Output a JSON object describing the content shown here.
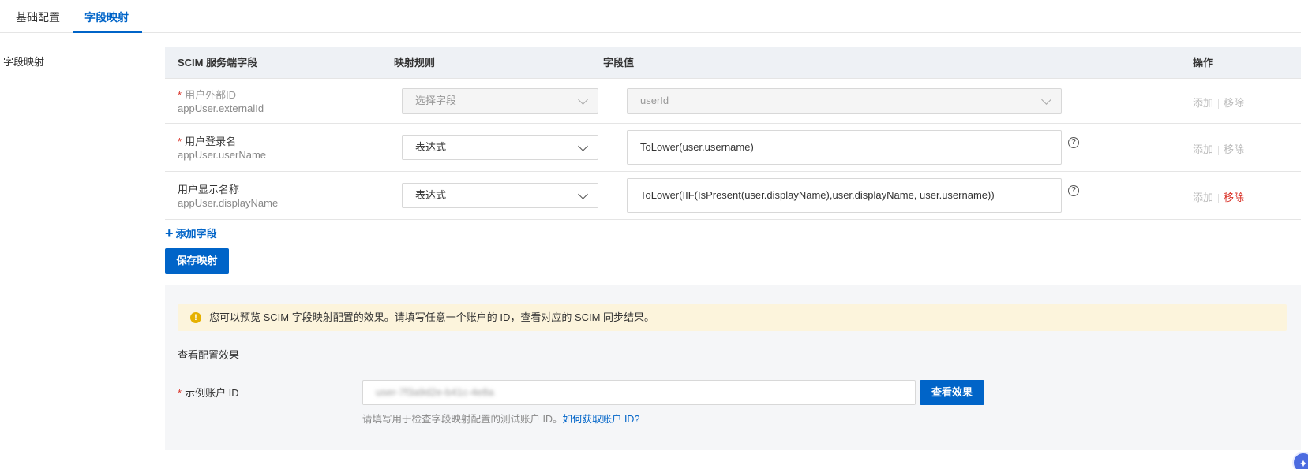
{
  "tabs": [
    {
      "label": "基础配置",
      "active": false
    },
    {
      "label": "字段映射",
      "active": true
    }
  ],
  "side_label": "字段映射",
  "table": {
    "headers": {
      "field": "SCIM 服务端字段",
      "rule": "映射规则",
      "value": "字段值",
      "ops": "操作"
    },
    "rows": [
      {
        "name": "用户外部ID",
        "required": "*",
        "code": "appUser.externalId",
        "rule": "选择字段",
        "value": "userId",
        "add": "添加",
        "remove": "移除"
      },
      {
        "name": "用户登录名",
        "required": "*",
        "code": "appUser.userName",
        "rule": "表达式",
        "value": "ToLower(user.username)",
        "add": "添加",
        "remove": "移除"
      },
      {
        "name": "用户显示名称",
        "code": "appUser.displayName",
        "rule": "表达式",
        "value": "ToLower(IIF(IsPresent(user.displayName),user.displayName, user.username))",
        "add": "添加",
        "remove": "移除"
      }
    ]
  },
  "add_field_label": "添加字段",
  "save_label": "保存映射",
  "preview": {
    "alert": "您可以预览 SCIM 字段映射配置的效果。请填写任意一个账户的 ID，查看对应的 SCIM 同步结果。",
    "section_title": "查看配置效果",
    "account_label": "示例账户 ID",
    "required": "*",
    "account_value": "user-7f3a9d2e-b41c-4e8a",
    "view_button": "查看效果",
    "hint": "请填写用于检查字段映射配置的测试账户 ID。",
    "hint_link": "如何获取账户 ID?"
  },
  "colors": {
    "primary": "#0064c8",
    "danger": "#d93026",
    "warning_bg": "#fcf4dc"
  }
}
